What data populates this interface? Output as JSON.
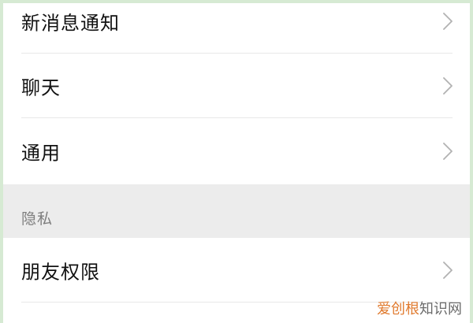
{
  "settings": {
    "rows": [
      {
        "label": "新消息通知",
        "icon": "chevron-right-icon"
      },
      {
        "label": "聊天",
        "icon": "chevron-right-icon"
      },
      {
        "label": "通用",
        "icon": "chevron-right-icon"
      }
    ],
    "section_title": "隐私",
    "privacy_rows": [
      {
        "label": "朋友权限",
        "icon": "chevron-right-icon"
      }
    ]
  },
  "watermark": {
    "part1": "爱创根",
    "part2": "知识网"
  },
  "colors": {
    "frame_edge": "#d6ead3",
    "section_background": "#ececec",
    "divider": "#e8e8e8",
    "chevron": "#b2b2b2",
    "watermark_accent": "#e07a2e"
  }
}
